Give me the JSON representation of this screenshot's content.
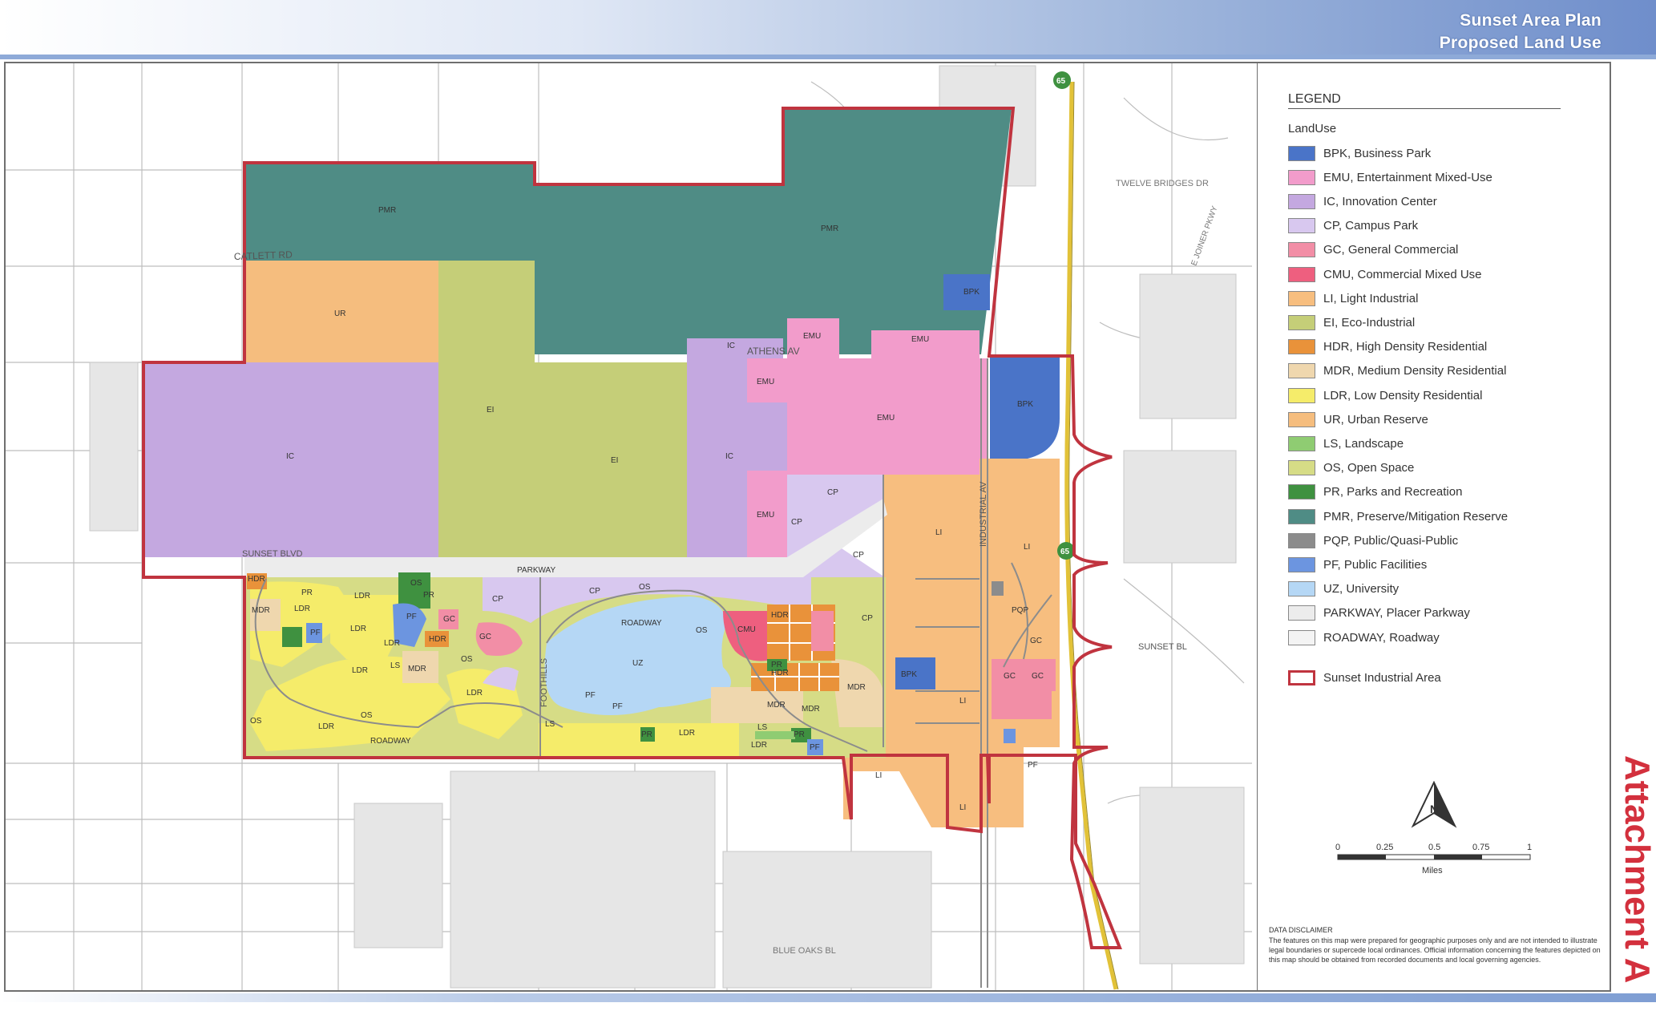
{
  "title": {
    "line1": "Sunset Area Plan",
    "line2": "Proposed Land Use"
  },
  "attachment_label": "Attachment A",
  "colors": {
    "BPK": "#4a74c8",
    "EMU": "#f29ccb",
    "IC": "#c4a8e0",
    "CP": "#d8c8ef",
    "GC": "#f28ea6",
    "CMU": "#ee5f7f",
    "LI": "#f7be7f",
    "EI": "#c5ce78",
    "HDR": "#e9923a",
    "MDR": "#efd7ae",
    "LDR": "#f5ec6a",
    "UR": "#f5bd7e",
    "LS": "#8fcc72",
    "OS": "#d6dc86",
    "PR": "#3f9140",
    "PMR": "#4f8c85",
    "PQP": "#8c8c8c",
    "PF": "#6c95e0",
    "UZ": "#b5d7f5",
    "PARKWAY": "#ececec",
    "ROADWAY": "#f4f4f4",
    "boundary": "#c0343f"
  },
  "legend": {
    "title": "LEGEND",
    "subtitle": "LandUse",
    "items": [
      {
        "code": "BPK",
        "label": "BPK, Business Park"
      },
      {
        "code": "EMU",
        "label": "EMU, Entertainment Mixed-Use"
      },
      {
        "code": "IC",
        "label": "IC, Innovation Center"
      },
      {
        "code": "CP",
        "label": "CP, Campus Park"
      },
      {
        "code": "GC",
        "label": "GC, General Commercial"
      },
      {
        "code": "CMU",
        "label": "CMU, Commercial Mixed Use"
      },
      {
        "code": "LI",
        "label": "LI, Light Industrial"
      },
      {
        "code": "EI",
        "label": "EI, Eco-Industrial"
      },
      {
        "code": "HDR",
        "label": "HDR, High Density Residential"
      },
      {
        "code": "MDR",
        "label": "MDR, Medium Density Residential"
      },
      {
        "code": "LDR",
        "label": "LDR, Low Density Residential"
      },
      {
        "code": "UR",
        "label": "UR, Urban Reserve"
      },
      {
        "code": "LS",
        "label": "LS, Landscape"
      },
      {
        "code": "OS",
        "label": "OS, Open Space"
      },
      {
        "code": "PR",
        "label": "PR, Parks and Recreation"
      },
      {
        "code": "PMR",
        "label": "PMR, Preserve/Mitigation Reserve"
      },
      {
        "code": "PQP",
        "label": "PQP, Public/Quasi-Public"
      },
      {
        "code": "PF",
        "label": "PF, Public Facilities"
      },
      {
        "code": "UZ",
        "label": "UZ, University"
      },
      {
        "code": "PARKWAY",
        "label": "PARKWAY, Placer Parkway"
      },
      {
        "code": "ROADWAY",
        "label": "ROADWAY, Roadway"
      }
    ],
    "boundary_label": "Sunset Industrial Area"
  },
  "scale": {
    "ticks": [
      "0",
      "0.25",
      "0.5",
      "0.75",
      "1"
    ],
    "unit": "Miles"
  },
  "north_label": "N",
  "disclaimer": {
    "title": "DATA DISCLAIMER",
    "text": "The features on this map were prepared for geographic purposes only and are not intended to illustrate legal boundaries or supercede local ordinances. Official information concerning the features depicted on this map should be obtained from recorded documents and local governing agencies."
  },
  "road_labels": {
    "catlett": "CATLETT RD",
    "athens": "ATHENS AV",
    "sunset": "SUNSET BLVD",
    "sunset_east": "SUNSET BL",
    "parkway": "PARKWAY",
    "roadway_center": "ROADWAY",
    "roadway_sw": "ROADWAY",
    "foothills": "FOOTHILLS",
    "industrial": "INDUSTRIAL AV",
    "twelve_bridges": "TWELVE BRIDGES DR",
    "blue_oaks": "BLUE OAKS BL",
    "joiner": "E JOINER PKWY",
    "hwy": "65"
  },
  "zone_labels": {
    "pmr_west": "PMR",
    "pmr_east": "PMR",
    "ur": "UR",
    "ic_west": "IC",
    "ei_1": "EI",
    "ei_2": "EI",
    "ic_center": "IC",
    "ic_athens": "IC",
    "emu_1": "EMU",
    "emu_2": "EMU",
    "emu_3": "EMU",
    "emu_4": "EMU",
    "emu_5": "EMU",
    "bpk_1": "BPK",
    "bpk_2": "BPK",
    "bpk_3": "BPK",
    "cp_1": "CP",
    "cp_2": "CP",
    "cp_3": "CP",
    "cp_4": "CP",
    "cp_5": "CP",
    "cp_6": "CP",
    "uz": "UZ",
    "gc_1": "GC",
    "gc_2": "GC",
    "gc_3": "GC",
    "gc_4": "GC",
    "gc_5": "GC",
    "cmu": "CMU",
    "li_1": "LI",
    "li_2": "LI",
    "li_3": "LI",
    "li_4": "LI",
    "li_5": "LI",
    "pqp": "PQP",
    "ldr_1": "LDR",
    "ldr_2": "LDR",
    "ldr_3": "LDR",
    "ldr_4": "LDR",
    "ldr_5": "LDR",
    "ldr_6": "LDR",
    "ldr_7": "LDR",
    "ldr_8": "LDR",
    "ldr_9": "LDR",
    "mdr_1": "MDR",
    "mdr_2": "MDR",
    "mdr_3": "MDR",
    "mdr_4": "MDR",
    "mdr_5": "MDR",
    "hdr_1": "HDR",
    "hdr_2": "HDR",
    "hdr_3": "HDR",
    "hdr_4": "HDR",
    "os_1": "OS",
    "os_2": "OS",
    "os_3": "OS",
    "os_4": "OS",
    "os_5": "OS",
    "os_6": "OS",
    "pr_1": "PR",
    "pr_2": "PR",
    "pr_3": "PR",
    "pr_4": "PR",
    "pr_5": "PR",
    "pf_1": "PF",
    "pf_2": "PF",
    "pf_3": "PF",
    "pf_4": "PF",
    "pf_5": "PF",
    "pf_6": "PF",
    "ls_1": "LS",
    "ls_2": "LS",
    "ls_3": "LS"
  }
}
